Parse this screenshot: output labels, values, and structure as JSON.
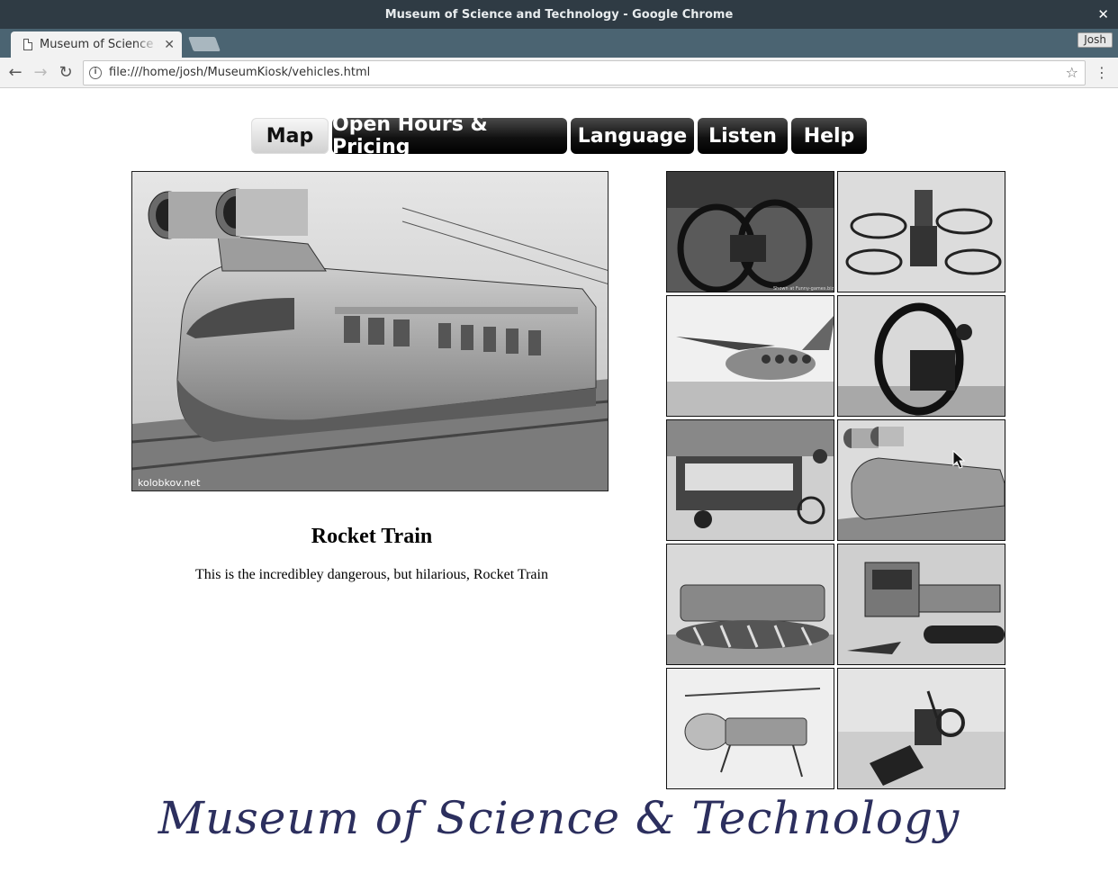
{
  "window": {
    "title": "Museum of Science and Technology - Google Chrome"
  },
  "tab": {
    "title": "Museum of Science and Technology"
  },
  "profile": {
    "name": "Josh"
  },
  "address_bar": {
    "url": "file:///home/josh/MuseumKiosk/vehicles.html"
  },
  "nav": {
    "buttons": [
      {
        "label": "Map",
        "active": true
      },
      {
        "label": "Open Hours & Pricing",
        "active": false
      },
      {
        "label": "Language",
        "active": false
      },
      {
        "label": "Listen",
        "active": false
      },
      {
        "label": "Help",
        "active": false
      }
    ]
  },
  "featured": {
    "title": "Rocket Train",
    "description": "This is the incredibley dangerous, but hilarious, Rocket Train",
    "watermark": "kolobkov.net"
  },
  "gallery": {
    "items": [
      {
        "name": "monowheel-car-thumbnail",
        "caption": "Shown at Funny-games.biz"
      },
      {
        "name": "hoverbike-thumbnail"
      },
      {
        "name": "ekranoplan-thumbnail"
      },
      {
        "name": "monowheel-motorcycle-thumbnail"
      },
      {
        "name": "bus-bicycle-thumbnail"
      },
      {
        "name": "rocket-train-thumbnail"
      },
      {
        "name": "screw-propelled-vehicle-thumbnail"
      },
      {
        "name": "tracked-truck-thumbnail"
      },
      {
        "name": "army-flying-platform-thumbnail"
      },
      {
        "name": "snow-motorcycle-thumbnail"
      }
    ]
  },
  "footer": {
    "title": "Museum of Science & Technology"
  }
}
